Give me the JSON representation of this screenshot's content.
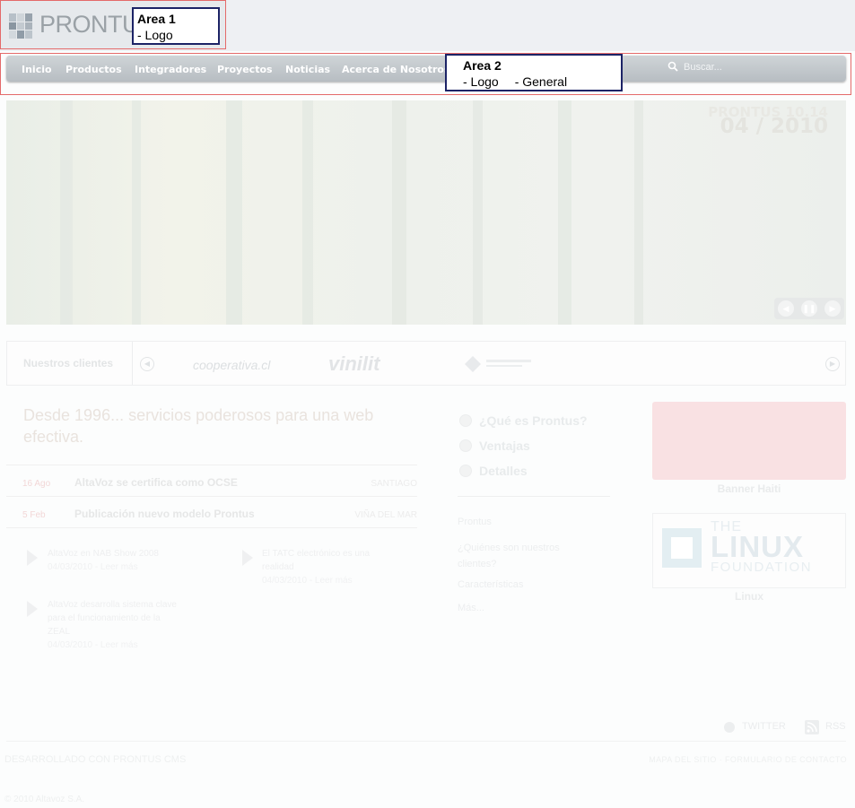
{
  "header": {
    "logo_text": "PRONTUS",
    "annotation1": {
      "title": "Area 1",
      "line1": "- Logo"
    },
    "annotation2": {
      "title": "Area 2",
      "line1": "- Logo",
      "line2": "- General"
    }
  },
  "nav": {
    "items": [
      "Inicio",
      "Productos",
      "Integradores",
      "Proyectos",
      "Noticias",
      "Acerca de Nosotros"
    ],
    "search_placeholder": "Buscar..."
  },
  "banner": {
    "tag1": "PRONTUS 10.14",
    "tag2": "04 / 2010"
  },
  "clients": {
    "label": "Nuestros clientes",
    "logos": [
      "cooperativa.cl",
      "vinilit"
    ]
  },
  "main": {
    "headline": "Desde 1996... servicios poderosos para una web efectiva.",
    "news": [
      {
        "date": "16 Ago",
        "title": "AltaVoz se certifica como OCSE",
        "location": "SANTIAGO"
      },
      {
        "date": "5 Feb",
        "title": "Publicación nuevo modelo Prontus",
        "location": "VIÑA DEL MAR"
      }
    ],
    "articles": [
      {
        "title": "AltaVoz en NAB Show 2008",
        "meta": "04/03/2010 - Leer más"
      },
      {
        "title": "El TATC electrónico es una realidad",
        "meta": "04/03/2010 - Leer más"
      },
      {
        "title": "AltaVoz desarrolla sistema clave para el funcionamiento de la ZEAL",
        "meta": "04/03/2010 - Leer más"
      }
    ],
    "questions": [
      "¿Qué es Prontus?",
      "Ventajas",
      "Detalles"
    ],
    "links": [
      "Prontus",
      "¿Quiénes son nuestros clientes?",
      "Características",
      "Más..."
    ]
  },
  "sidebar": {
    "banner_haiti": "Banner Haiti",
    "linux_the": "THE",
    "linux_big": "LINUX",
    "linux_foundation": "FOUNDATION",
    "linux_label": "Linux"
  },
  "footer": {
    "twitter": "TWITTER",
    "rss": "RSS",
    "developed": "DESARROLLADO CON PRONTUS CMS",
    "links": "MAPA DEL SITIO · FORMULARIO DE CONTACTO",
    "copyright": "© 2010 Altavoz S.A."
  },
  "colors": {
    "accent": "#e46a6a",
    "note_border": "#1c2366",
    "nav": "#c4c9cd"
  }
}
